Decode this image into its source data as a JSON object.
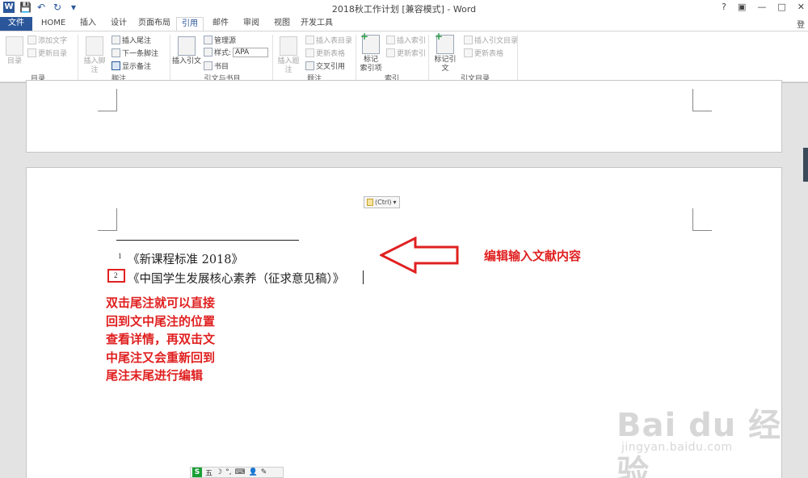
{
  "title_bar": {
    "title": "2018秋工作计划 [兼容模式] - Word",
    "help": "?",
    "restore": "▣",
    "minimize": "—",
    "maximize": "□",
    "close": "✕",
    "qat_save": "💾",
    "qat_undo": "↶",
    "qat_redo": "↻",
    "qat_more": "▾"
  },
  "tabs": [
    "文件",
    "HOME",
    "插入",
    "设计",
    "页面布局",
    "引用",
    "邮件",
    "审阅",
    "视图",
    "开发工具"
  ],
  "user_corner": "登",
  "ribbon": {
    "toc": {
      "big": "目录",
      "add_text": "添加文字",
      "update": "更新目录",
      "label": "目录"
    },
    "footnote": {
      "insert_footnote": "插入脚注",
      "insert_endnote": "插入尾注",
      "next_footnote": "下一条脚注",
      "show_notes": "显示备注",
      "label": "脚注"
    },
    "citations": {
      "insert_citation": "插入引文",
      "manage_sources": "管理源",
      "style_label": "样式:",
      "style_value": "APA",
      "bibliography": "书目",
      "label": "引文与书目"
    },
    "captions": {
      "insert_caption": "插入题注",
      "insert_table_of_figures": "插入表目录",
      "update_table": "更新表格",
      "cross_reference": "交叉引用",
      "label": "题注"
    },
    "index": {
      "mark_entry_line1": "标记",
      "mark_entry_line2": "索引项",
      "insert_index": "插入索引",
      "update_index": "更新索引",
      "label": "索引"
    },
    "toa": {
      "mark_citation": "标记引文",
      "insert_toa": "插入引文目录",
      "update_table": "更新表格",
      "label": "引文目录"
    }
  },
  "document": {
    "paste_options": "(Ctrl)",
    "endnotes": [
      {
        "num": "1",
        "text": "《新课程标准 2018》"
      },
      {
        "num": "2",
        "text": "《中国学生发展核心素养（征求意见稿）》"
      }
    ],
    "annotation_right": "编辑输入文献内容",
    "annotation_left": [
      "双击尾注就可以直接",
      "回到文中尾注的位置",
      "查看详情，再双击文",
      "中尾注又会重新回到",
      "尾注末尾进行编辑"
    ],
    "watermark_main": "Bai du 经验",
    "watermark_sub": "jingyan.baidu.com",
    "ime_label": "五"
  }
}
